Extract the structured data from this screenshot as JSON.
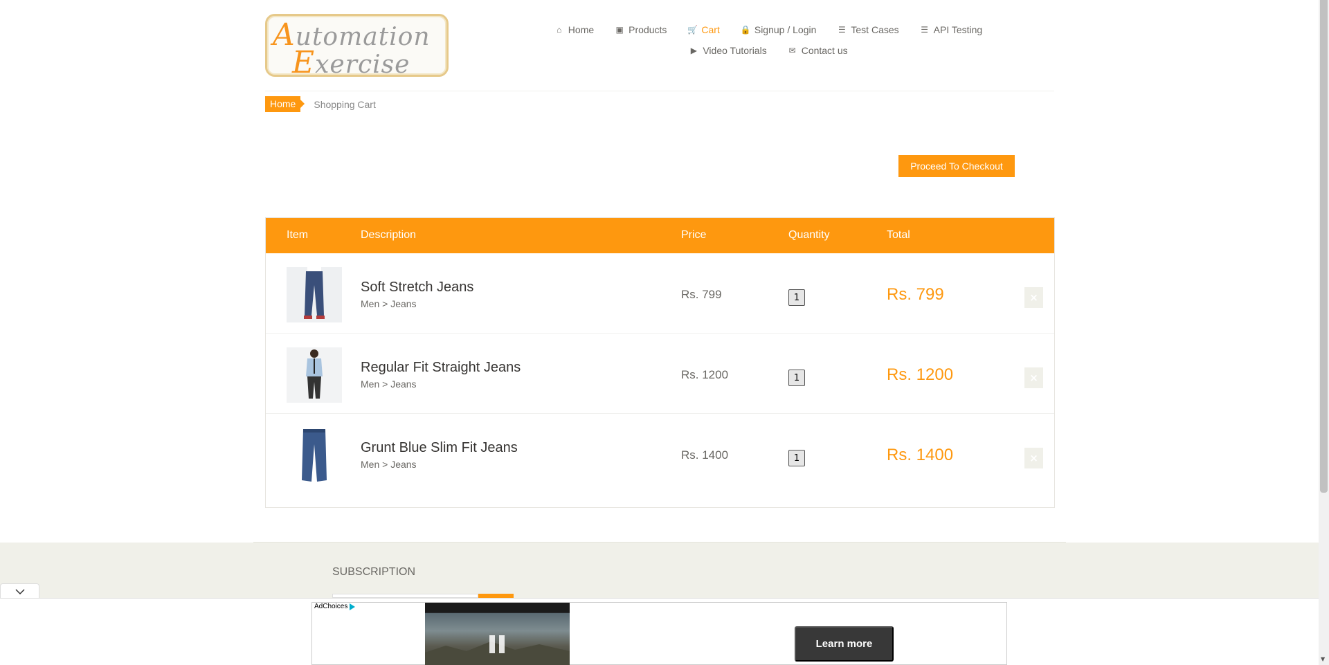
{
  "logo": {
    "line1_cap": "A",
    "line1_rest": "utomation",
    "line2_cap": "E",
    "line2_rest": "xercise"
  },
  "nav": {
    "row1": [
      {
        "label": "Home",
        "icon": "home-icon",
        "glyph": "⌂"
      },
      {
        "label": "Products",
        "icon": "briefcase-icon",
        "glyph": "▣"
      },
      {
        "label": "Cart",
        "icon": "cart-icon",
        "glyph": "🛒",
        "active": true
      },
      {
        "label": "Signup / Login",
        "icon": "lock-icon",
        "glyph": "🔒"
      },
      {
        "label": "Test Cases",
        "icon": "list-icon",
        "glyph": "☰"
      },
      {
        "label": "API Testing",
        "icon": "list-icon",
        "glyph": "☰"
      }
    ],
    "row2": [
      {
        "label": "Video Tutorials",
        "icon": "youtube-icon",
        "glyph": "▶"
      },
      {
        "label": "Contact us",
        "icon": "envelope-icon",
        "glyph": "✉"
      }
    ]
  },
  "breadcrumb": {
    "home": "Home",
    "current": "Shopping Cart"
  },
  "checkout_button": "Proceed To Checkout",
  "cart": {
    "headers": {
      "item": "Item",
      "description": "Description",
      "price": "Price",
      "quantity": "Quantity",
      "total": "Total"
    },
    "rows": [
      {
        "name": "Soft Stretch Jeans",
        "category": "Men > Jeans",
        "price": "Rs. 799",
        "quantity": "1",
        "total": "Rs. 799",
        "delete": "×"
      },
      {
        "name": "Regular Fit Straight Jeans",
        "category": "Men > Jeans",
        "price": "Rs. 1200",
        "quantity": "1",
        "total": "Rs. 1200",
        "delete": "×"
      },
      {
        "name": "Grunt Blue Slim Fit Jeans",
        "category": "Men > Jeans",
        "price": "Rs. 1400",
        "quantity": "1",
        "total": "Rs. 1400",
        "delete": "×"
      }
    ]
  },
  "subscription": {
    "title": "SUBSCRIPTION"
  },
  "ad": {
    "adchoices": "AdChoices",
    "learn_more": "Learn more",
    "toggle_icon": "chevron-down-icon"
  },
  "colors": {
    "accent": "#fe980f",
    "text": "#696763",
    "footer_bg": "#f0f0e9"
  }
}
